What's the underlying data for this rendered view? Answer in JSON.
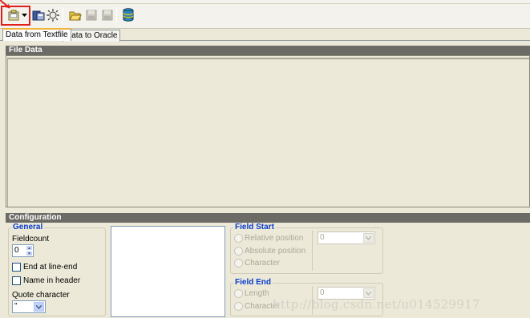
{
  "tabs": [
    {
      "label": "Data from Textfile",
      "active": true
    },
    {
      "label": "Data to Oracle",
      "active": false
    }
  ],
  "toolbar": {
    "icons": [
      "open-file-icon",
      "dropdown-arrow-icon",
      "open-database-icon",
      "settings-icon",
      "folder-open-icon",
      "save-icon",
      "save-disabled-icon",
      "database-icon"
    ],
    "highlight_color": "#e0201b"
  },
  "file_data": {
    "title": "File Data"
  },
  "configuration": {
    "title": "Configuration",
    "general": {
      "title": "General",
      "fieldcount_label": "Fieldcount",
      "fieldcount_value": "0",
      "end_at_line_end_label": "End at line-end",
      "end_at_line_end_checked": false,
      "name_in_header_label": "Name in header",
      "name_in_header_checked": false,
      "quote_character_label": "Quote character",
      "quote_character_value": "\""
    },
    "field_start": {
      "title": "Field Start",
      "options": [
        "Relative position",
        "Absolute position",
        "Character"
      ],
      "value": "0"
    },
    "field_end": {
      "title": "Field End",
      "options": [
        "Length",
        "Character"
      ],
      "value": "0"
    }
  },
  "watermark": "http://blog.csdn.net/u014529917"
}
